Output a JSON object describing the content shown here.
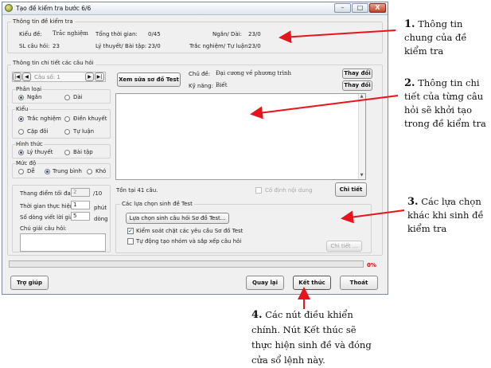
{
  "window": {
    "title": "Tạo đề kiểm tra bước 6/6",
    "minimize": "–",
    "maximize": "□",
    "close": "X"
  },
  "general": {
    "legend": "Thông tin đề kiểm tra",
    "kieu_de_label": "Kiểu đề:",
    "kieu_de_value": "Trắc nghiệm",
    "tong_tg_label": "Tổng thời gian:",
    "tong_tg_value": "0/45",
    "ngan_dai_label": "Ngắn/ Dài:",
    "ngan_dai_value": "23/0",
    "sl_cau_label": "SL câu hỏi:",
    "sl_cau_value": "23",
    "lt_bt_label": "Lý thuyết/ Bài tập:",
    "lt_bt_value": "23/0",
    "tn_tl_label": "Trắc nghiệm/ Tự luận:",
    "tn_tl_value": "23/0"
  },
  "detail": {
    "legend": "Thông tin chi tiết các câu hỏi",
    "nav": {
      "first": "|◀",
      "prev": "◀",
      "question_label": "Câu số: 1",
      "next": "▶",
      "last": "▶|"
    },
    "phan_loai": {
      "legend": "Phân loại",
      "options": [
        "Ngắn",
        "Dài"
      ],
      "selected": "Ngắn"
    },
    "kieu": {
      "legend": "Kiểu",
      "options": [
        "Trắc nghiệm",
        "Điền khuyết",
        "Cặp đôi",
        "Tự luận"
      ],
      "selected": "Trắc nghiệm"
    },
    "hinh_thuc": {
      "legend": "Hình thức",
      "options": [
        "Lý thuyết",
        "Bài tập"
      ],
      "selected": "Lý thuyết"
    },
    "muc_do": {
      "legend": "Mức độ",
      "options": [
        "Dễ",
        "Trung bình",
        "Khó"
      ],
      "selected": "Trung bình"
    },
    "xem_sua_button": "Xem sửa sơ đồ Test",
    "chu_de_label": "Chủ đề:",
    "chu_de_value": "Đại cương về phương trình",
    "ky_nang_label": "Kỹ năng:",
    "ky_nang_value": "Biết",
    "thay_doi_1": "Thay đổi",
    "thay_doi_2": "Thay đổi",
    "ton_tai": "Tồn tại 41 câu.",
    "co_dinh_label": "Cố định nội dung",
    "chi_tiet_button": "Chi tiết"
  },
  "settings": {
    "thang_diem_label": "Thang điểm tối đa:",
    "thang_diem_value": "2",
    "thang_diem_suffix": "/10",
    "thoi_gian_label": "Thời gian thực hiện:",
    "thoi_gian_value": "1",
    "thoi_gian_suffix": "phút",
    "so_dong_label": "Số dòng viết lời giải:",
    "so_dong_value": "5",
    "so_dong_suffix": "dòng",
    "chu_giai_label": "Chú giải câu hỏi:"
  },
  "options": {
    "legend": "Các lựa chọn sinh đề Test",
    "lua_chon_button": "Lựa chọn sinh câu hỏi Sơ đồ Test...",
    "kiem_soat_label": "Kiểm soát chặt các yêu cầu Sơ đồ Test",
    "kiem_soat_checked": true,
    "tu_dong_label": "Tự động tạo nhóm và sắp xếp câu hỏi",
    "tu_dong_checked": false,
    "chi_tiet_button": "Chi tiết ..."
  },
  "progress": {
    "value": 0,
    "label": "0%"
  },
  "buttons": {
    "tro_giup": "Trợ giúp",
    "quay_lai": "Quay lại",
    "ket_thuc": "Kết thúc",
    "thoat": "Thoát"
  },
  "annotations": {
    "a1_num": "1.",
    "a1_text": "Thông tin chung của đề kiểm tra",
    "a2_num": "2.",
    "a2_text": "Thông tin chi tiết của từng câu hỏi sẽ khởi tạo trong đề kiểm tra",
    "a3_num": "3.",
    "a3_text": "Các lựa chọn khác khi sinh đề kiểm tra",
    "a4_num": "4.",
    "a4_text": "Các nút điều khiển chính. Nút Kết thúc sẽ thực hiện sinh đề và đóng cửa sổ lệnh này."
  },
  "colors": {
    "arrow": "#e8141c",
    "progress_label": "#d01010",
    "accent": "#1f4f9c"
  }
}
